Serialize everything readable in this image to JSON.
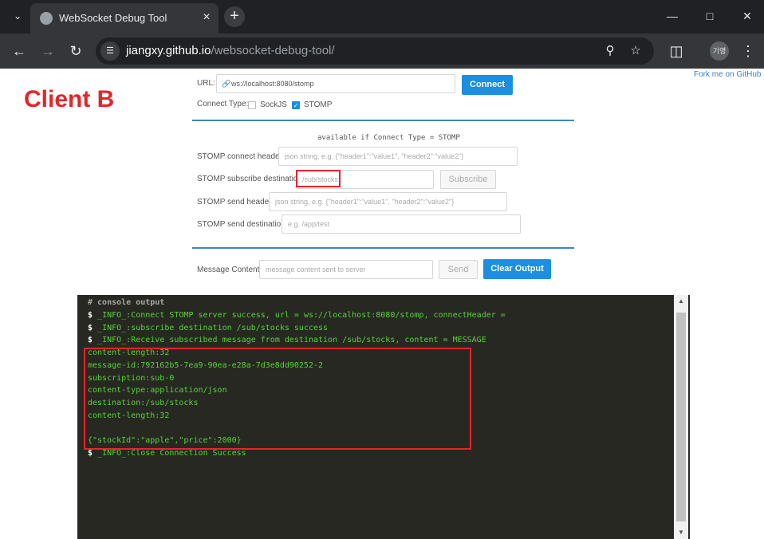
{
  "browser": {
    "tab_title": "WebSocket Debug Tool",
    "url_host": "jiangxy.github.io",
    "url_path": "/websocket-debug-tool/",
    "profile_initials": "기영"
  },
  "page": {
    "client_label": "Client B",
    "fork_link": "Fork me on GitHub",
    "url_label": "URL:",
    "url_value": "ws://localhost:8080/stomp",
    "connect_button": "Connect",
    "connect_type_label": "Connect Type:",
    "sockjs_label": "SockJS",
    "sockjs_checked": false,
    "stomp_label": "STOMP",
    "stomp_checked": true,
    "stomp_hint": "available if Connect Type = STOMP",
    "stomp_connect_header_label": "STOMP connect header:",
    "stomp_connect_header_placeholder": "json string, e.g. {\"header1\":\"value1\", \"header2\":\"value2\"}",
    "stomp_subscribe_label": "STOMP subscribe destination:",
    "stomp_subscribe_value": "/sub/stocks",
    "subscribe_button": "Subscribe",
    "stomp_send_header_label": "STOMP send header:",
    "stomp_send_header_placeholder": "json string, e.g. {\"header1\":\"value1\", \"header2\":\"value2\"}",
    "stomp_send_dest_label": "STOMP send destination:",
    "stomp_send_dest_placeholder": "e.g. /app/test",
    "message_content_label": "Message Content:",
    "message_content_placeholder": "message content sent to server",
    "send_button": "Send",
    "clear_button": "Clear Output"
  },
  "console": {
    "header": "# console output",
    "prompt": "$",
    "info_lines": [
      "_INFO_:Connect STOMP server success, url = ws://localhost:8080/stomp, connectHeader =",
      "_INFO_:subscribe destination /sub/stocks success",
      "_INFO_:Receive subscribed message from destination /sub/stocks, content = MESSAGE"
    ],
    "message_lines": [
      "content-length:32",
      "message-id:792162b5-7ea9-90ea-e28a-7d3e8dd90252-2",
      "subscription:sub-0",
      "content-type:application/json",
      "destination:/sub/stocks",
      "content-length:32",
      "",
      "{\"stockId\":\"apple\",\"price\":2000}"
    ],
    "close_line": "_INFO_:Close Connection Success"
  },
  "colors": {
    "accent": "#1a8fe3",
    "annotation": "#e8232a",
    "console_bg": "#272822",
    "console_text": "#55d436"
  }
}
